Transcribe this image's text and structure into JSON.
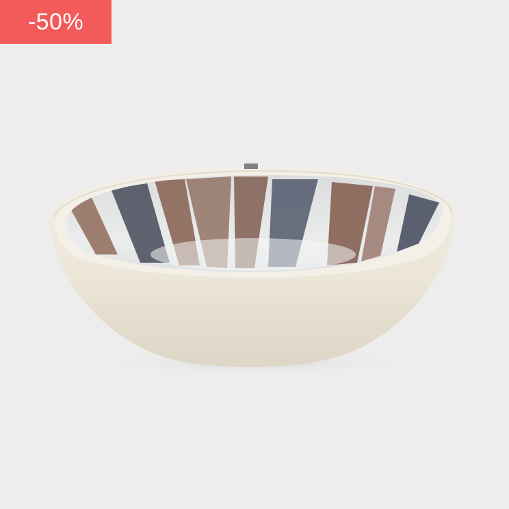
{
  "badge": {
    "label": "-50%",
    "color": "#f35a5a"
  },
  "product": {
    "image_icon": "striped-ceramic-bowl"
  },
  "colors": {
    "background": "#ededed",
    "bowl_outer": "#efeadd",
    "stripe_brown": "#8c6a5c",
    "stripe_gray": "#5a5f6c"
  }
}
